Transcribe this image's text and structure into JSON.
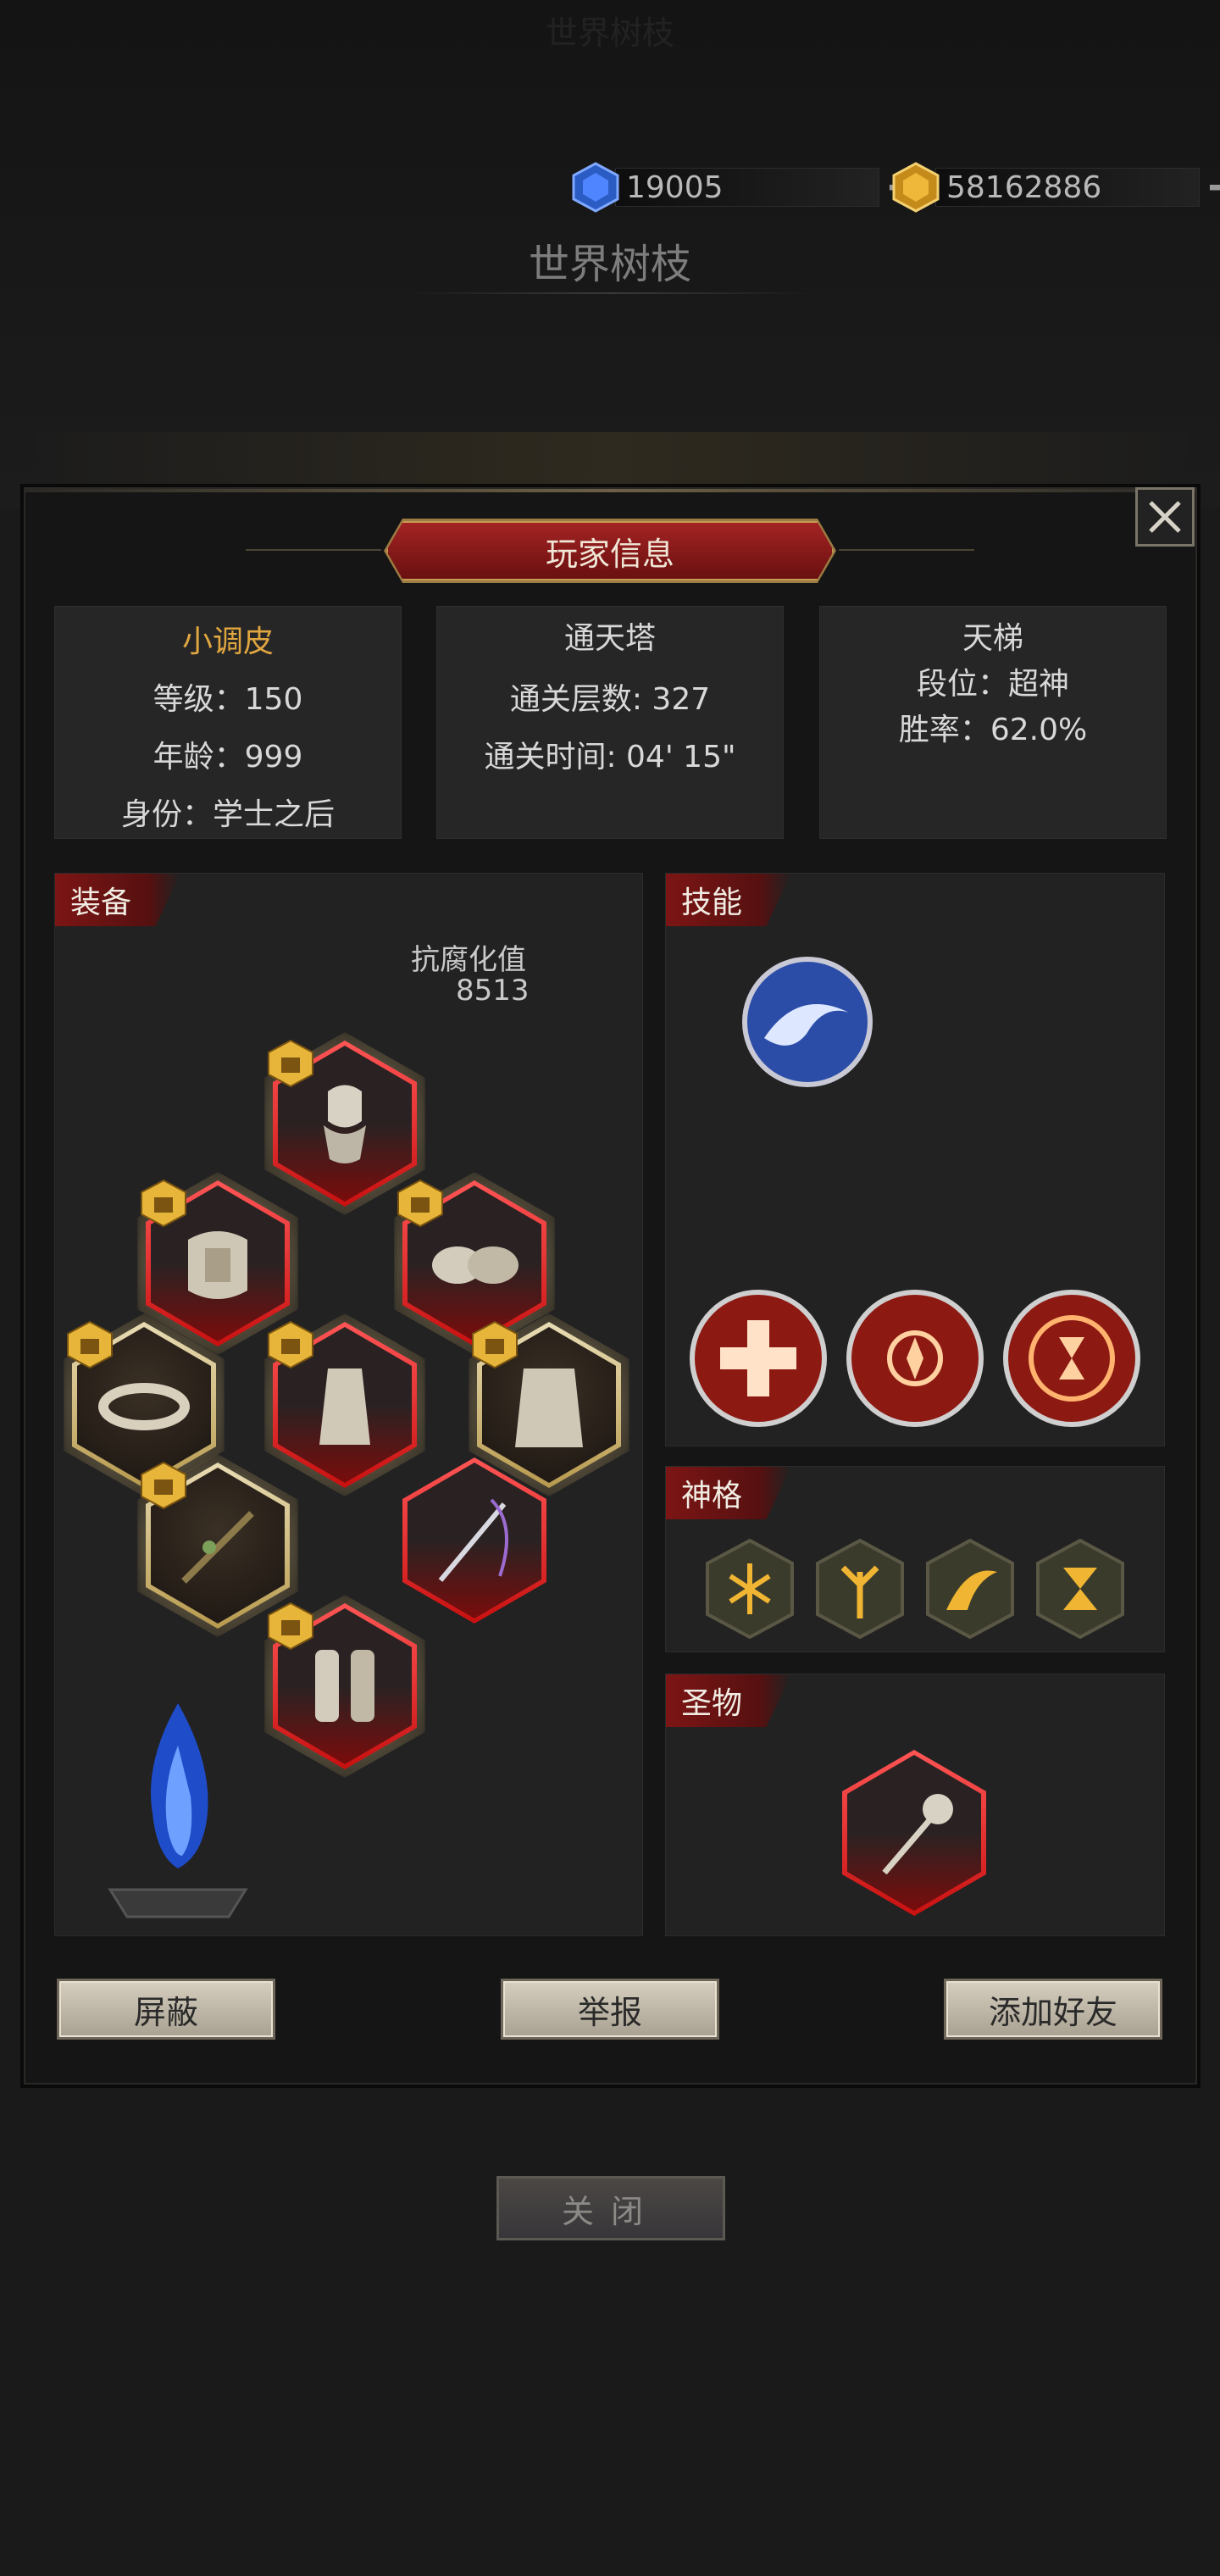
{
  "background": {
    "top_title": "世界树枝",
    "page_title": "世界树枝",
    "currencies": [
      {
        "name": "blue-gem-icon",
        "value": "19005"
      },
      {
        "name": "gold-gem-icon",
        "value": "58162886"
      }
    ]
  },
  "modal": {
    "title": "玩家信息",
    "player": {
      "name": "小调皮",
      "level": "等级：150",
      "age": "年龄：999",
      "identity": "身份：学士之后"
    },
    "tower": {
      "title": "通天塔",
      "floors": "通关层数: 327",
      "time": "通关时间: 04' 15\""
    },
    "ladder": {
      "title": "天梯",
      "rank": "段位：超神",
      "winrate": "胜率：62.0%"
    },
    "equipment": {
      "tag": "装备",
      "corruption_label": "抗腐化值",
      "corruption_value": "8513"
    },
    "skills": {
      "tag": "技能"
    },
    "divinity": {
      "tag": "神格"
    },
    "relic": {
      "tag": "圣物"
    },
    "buttons": {
      "block": "屏蔽",
      "report": "举报",
      "add_friend": "添加好友"
    }
  },
  "close_label": "关闭",
  "colors": {
    "player_name": "#e0a640",
    "banner_red": "#8f1a1a",
    "button_beige": "#c8c0b0"
  }
}
